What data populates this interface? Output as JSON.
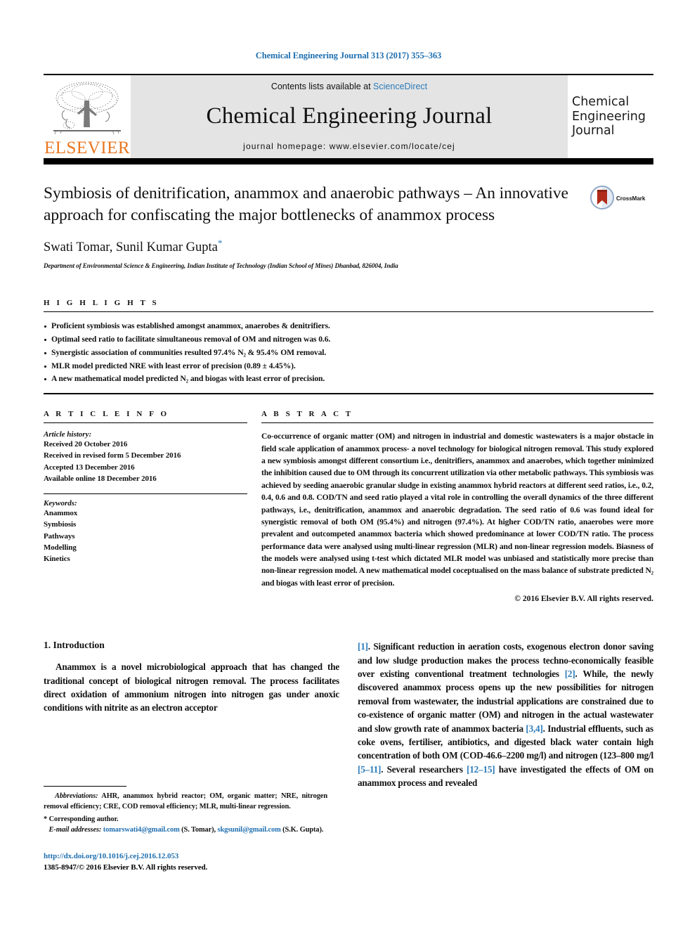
{
  "citation": "Chemical Engineering Journal 313 (2017) 355–363",
  "masthead": {
    "contents_prefix": "Contents lists available at ",
    "sciencedirect": "ScienceDirect",
    "journal_title": "Chemical Engineering Journal",
    "homepage": "journal homepage: www.elsevier.com/locate/cej",
    "publisher_logo_word": "ELSEVIER",
    "cover_line1": "Chemical",
    "cover_line2": "Engineering",
    "cover_line3": "Journal",
    "accent_link_color": "#2b7bb9",
    "publisher_color": "#E87722",
    "band_color": "#e4e4e4"
  },
  "article": {
    "title": "Symbiosis of denitrification, anammox and anaerobic pathways – An innovative approach for confiscating the major bottlenecks of anammox process",
    "authors": "Swati Tomar, Sunil Kumar Gupta",
    "corresponding_marker": "*",
    "affiliation": "Department of Environmental Science & Engineering, Indian Institute of Technology (Indian School of Mines) Dhanbad, 826004, India",
    "crossmark_label": "CrossMark"
  },
  "highlights": {
    "heading": "H I G H L I G H T S",
    "items": [
      "Proficient symbiosis was established amongst anammox, anaerobes & denitrifiers.",
      "Optimal seed ratio to facilitate simultaneous removal of OM and nitrogen was 0.6.",
      "Synergistic association of communities resulted 97.4% N₂ & 95.4% OM removal.",
      "MLR model predicted NRE with least error of precision (0.89 ± 4.45%).",
      "A new mathematical model predicted N₂ and biogas with least error of precision."
    ]
  },
  "article_info": {
    "heading": "A R T I C L E    I N F O",
    "history_label": "Article history:",
    "history": [
      "Received 20 October 2016",
      "Received in revised form 5 December 2016",
      "Accepted 13 December 2016",
      "Available online 18 December 2016"
    ],
    "keywords_label": "Keywords:",
    "keywords": [
      "Anammox",
      "Symbiosis",
      "Pathways",
      "Modelling",
      "Kinetics"
    ]
  },
  "abstract": {
    "heading": "A B S T R A C T",
    "text": "Co-occurrence of organic matter (OM) and nitrogen in industrial and domestic wastewaters is a major obstacle in field scale application of anammox process- a novel technology for biological nitrogen removal. This study explored a new symbiosis amongst different consortium i.e., denitrifiers, anammox and anaerobes, which together minimized the inhibition caused due to OM through its concurrent utilization via other metabolic pathways. This symbiosis was achieved by seeding anaerobic granular sludge in existing anammox hybrid reactors at different seed ratios, i.e., 0.2, 0.4, 0.6 and 0.8. COD/TN and seed ratio played a vital role in controlling the overall dynamics of the three different pathways, i.e., denitrification, anammox and anaerobic degradation. The seed ratio of 0.6 was found ideal for synergistic removal of both OM (95.4%) and nitrogen (97.4%). At higher COD/TN ratio, anaerobes were more prevalent and outcompeted anammox bacteria which showed predominance at lower COD/TN ratio. The process performance data were analysed using multi-linear regression (MLR) and non-linear regression models. Biasness of the models were analysed using t-test which dictated MLR model was unbiased and statistically more precise than non-linear regression model. A new mathematical model coceptualised on the mass balance of substrate predicted N₂ and biogas with least error of precision.",
    "copyright": "© 2016 Elsevier B.V. All rights reserved."
  },
  "introduction": {
    "section_title": "1. Introduction",
    "left_paragraph": "Anammox is a novel microbiological approach that has changed the traditional concept of biological nitrogen removal. The process facilitates direct oxidation of ammonium nitrogen into nitrogen gas under anoxic conditions with nitrite as an electron acceptor",
    "right_parts": [
      {
        "type": "ref",
        "text": "[1]"
      },
      {
        "type": "text",
        "text": ". Significant reduction in aeration costs, exogenous electron donor saving and low sludge production makes the process techno-economically feasible over existing conventional treatment technologies "
      },
      {
        "type": "ref",
        "text": "[2]"
      },
      {
        "type": "text",
        "text": ". While, the newly discovered anammox process opens up the new possibilities for nitrogen removal from wastewater, the industrial applications are constrained due to co-existence of organic matter (OM) and nitrogen in the actual wastewater and slow growth rate of anammox bacteria "
      },
      {
        "type": "ref",
        "text": "[3,4]"
      },
      {
        "type": "text",
        "text": ". Industrial effluents, such as coke ovens, fertiliser, antibiotics, and digested black water contain high concentration of both OM (COD-46.6–2200 mg/l) and nitrogen (123–800 mg/l "
      },
      {
        "type": "ref",
        "text": "[5–11]"
      },
      {
        "type": "text",
        "text": ". Several researchers "
      },
      {
        "type": "ref",
        "text": "[12–15]"
      },
      {
        "type": "text",
        "text": " have investigated the effects of OM on anammox process and revealed"
      }
    ]
  },
  "footnote": {
    "abbrev_label": "Abbreviations:",
    "abbrev_text": " AHR, anammox hybrid reactor; OM, organic matter; NRE, nitrogen removal efficiency; CRE, COD removal efficiency; MLR, multi-linear regression.",
    "corresponding": "* Corresponding author.",
    "email_label": "E-mail addresses:",
    "email_1": "tomarswati4@gmail.com",
    "email_1_owner": " (S. Tomar), ",
    "email_2": "skgsunil@gmail.com",
    "email_2_owner": " (S.K. Gupta).",
    "doi": "http://dx.doi.org/10.1016/j.cej.2016.12.053",
    "issn_line": "1385-8947/© 2016 Elsevier B.V. All rights reserved."
  }
}
